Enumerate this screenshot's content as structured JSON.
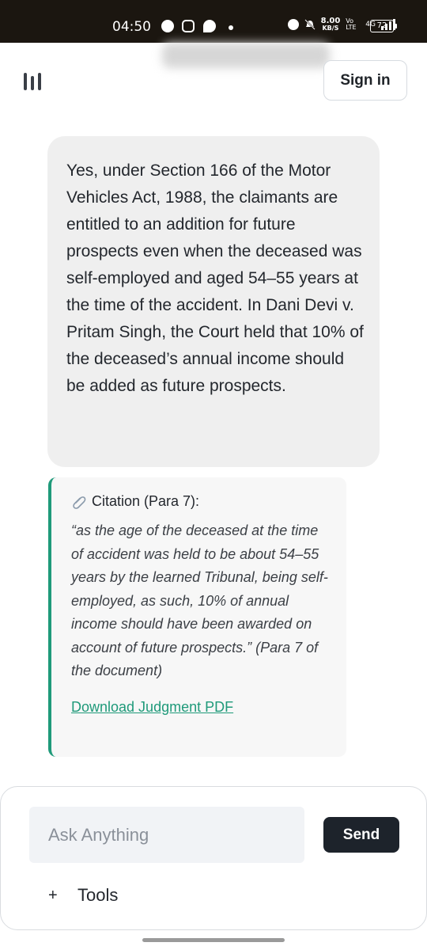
{
  "status_bar": {
    "time": "04:50",
    "net_speed": "8.00",
    "net_unit": "KB/S",
    "volte": "Vo LTE",
    "network": "4G",
    "battery": "72"
  },
  "header": {
    "sign_in_label": "Sign in"
  },
  "answer": {
    "text": "Yes, under Section 166 of the Motor Vehicles Act, 1988, the claimants are entitled to an addition for future prospects even when the deceased was self-employed and aged 54–55 years at the time of the accident. In Dani Devi v. Pritam Singh, the Court held that 10% of the deceased’s annual income should be added as future prospects."
  },
  "citation": {
    "title": "Citation (Para 7):",
    "quote": "“as the age of the deceased at the time of accident was held to be about 54–55 years by the learned Tribunal, being self-employed, as such, 10% of annual income should have been awarded on account of future prospects.” (Para 7 of the document)",
    "link_label": "Download Judgment PDF"
  },
  "composer": {
    "placeholder": "Ask Anything",
    "value": "",
    "send_label": "Send",
    "plus_label": "+",
    "tools_label": "Tools"
  },
  "colors": {
    "accent": "#1f9a7a",
    "send_button": "#1d232b",
    "status_bar": "#1b1610"
  },
  "icons": [
    "menu-icon",
    "paperclip-icon",
    "telegram-icon",
    "instagram-icon",
    "alarm-icon",
    "mute-icon",
    "signal-icon",
    "battery-icon"
  ]
}
